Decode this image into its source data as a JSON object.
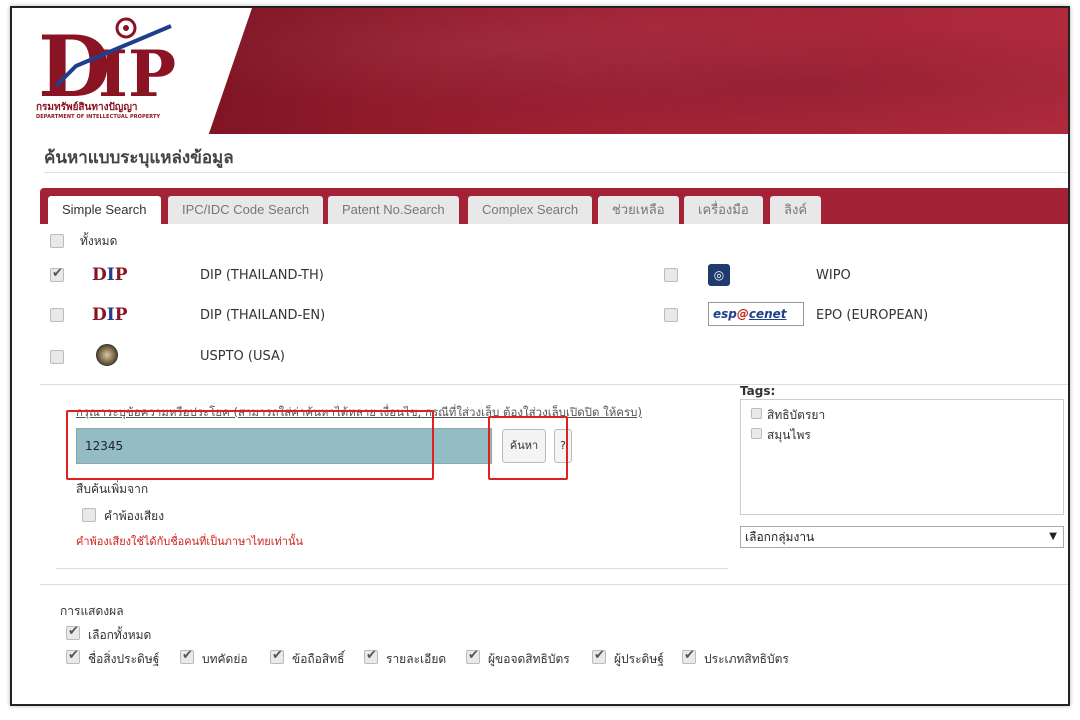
{
  "header": {
    "logo_text": "DIP",
    "org_thai": "กรมทรัพย์สินทางปัญญา",
    "org_en": "DEPARTMENT OF INTELLECTUAL PROPERTY"
  },
  "page": {
    "title": "ค้นหาแบบระบุแหล่งข้อมูล"
  },
  "tabs": [
    {
      "label": "Simple Search"
    },
    {
      "label": "IPC/IDC Code Search"
    },
    {
      "label": "Patent No.Search"
    },
    {
      "label": "Complex Search"
    },
    {
      "label": "ช่วยเหลือ"
    },
    {
      "label": "เครื่องมือ"
    },
    {
      "label": "ลิงค์"
    }
  ],
  "sources": {
    "all_label": "ทั้งหมด",
    "items": [
      {
        "label": "DIP (THAILAND-TH)",
        "checked": true,
        "icon": "dip-logo-icon"
      },
      {
        "label": "DIP (THAILAND-EN)",
        "checked": false,
        "icon": "dip-logo-icon"
      },
      {
        "label": "USPTO (USA)",
        "checked": false,
        "icon": "uspto-seal-icon"
      },
      {
        "label": "WIPO",
        "checked": false,
        "icon": "wipo-logo-icon"
      },
      {
        "label": "EPO (EUROPEAN)",
        "checked": false,
        "icon": "espacenet-logo-icon"
      }
    ]
  },
  "search": {
    "hint": "กรุณาระบุข้อความหรือประโยค (สามารถใส่ค่าค้นหาได้หลาย เงื่อนไข, กรณีที่ใส่วงเล็บ ต้องใส่วงเล็บเปิดปิด ให้ครบ)",
    "value": "12345",
    "search_button": "ค้นหา",
    "help_button": "?",
    "extra_label": "สืบค้นเพิ่มจาก",
    "homophone_label": "คำพ้องเสียง",
    "homophone_note": "คำพ้องเสียงใช้ได้กับชื่อคนที่เป็นภาษาไทยเท่านั้น"
  },
  "tags": {
    "label": "Tags:",
    "items": [
      {
        "label": "สิทธิบัตรยา"
      },
      {
        "label": "สมุนไพร"
      }
    ],
    "group_select": "เลือกกลุ่มงาน"
  },
  "display": {
    "label": "การแสดงผล",
    "select_all": "เลือกทั้งหมด",
    "fields": [
      {
        "label": "ชื่อสิ่งประดิษฐ์"
      },
      {
        "label": "บทคัดย่อ"
      },
      {
        "label": "ข้อถือสิทธิ์"
      },
      {
        "label": "รายละเอียด"
      },
      {
        "label": "ผู้ขอจดสิทธิบัตร"
      },
      {
        "label": "ผู้ประดิษฐ์"
      },
      {
        "label": "ประเภทสิทธิบัตร"
      }
    ]
  },
  "colors": {
    "brand": "#a32236",
    "input_bg": "#93bdc2",
    "highlight": "#e02020",
    "note": "#d0211c"
  }
}
